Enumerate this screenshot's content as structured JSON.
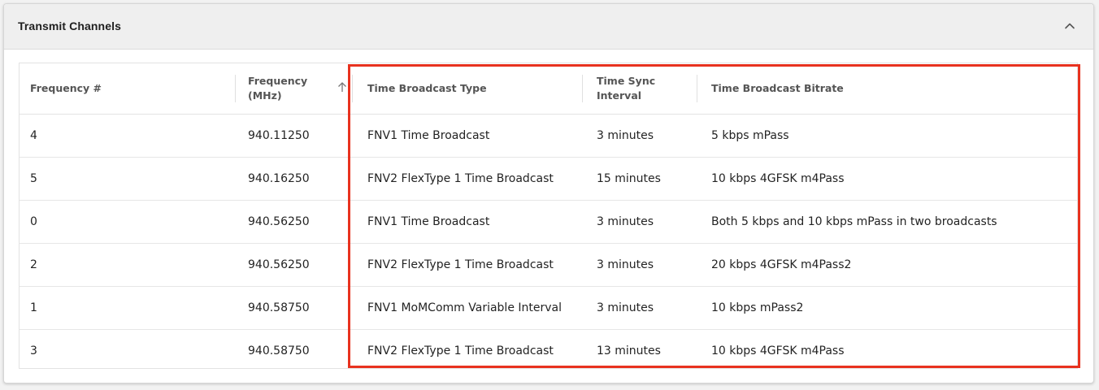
{
  "panel": {
    "title": "Transmit Channels",
    "collapse_icon": "chevron-up-icon"
  },
  "table": {
    "columns": [
      {
        "line1": "Frequency #",
        "line2": ""
      },
      {
        "line1": "Frequency",
        "line2": "(MHz)"
      },
      {
        "line1": "Time Broadcast Type",
        "line2": ""
      },
      {
        "line1": "Time Sync",
        "line2": "Interval"
      },
      {
        "line1": "Time Broadcast Bitrate",
        "line2": ""
      }
    ],
    "sort_icon": "arrow-up-icon",
    "rows": [
      [
        "4",
        "940.11250",
        "FNV1 Time Broadcast",
        "3 minutes",
        "5 kbps mPass"
      ],
      [
        "5",
        "940.16250",
        "FNV2 FlexType 1 Time Broadcast",
        "15 minutes",
        "10 kbps 4GFSK m4Pass"
      ],
      [
        "0",
        "940.56250",
        "FNV1 Time Broadcast",
        "3 minutes",
        "Both 5 kbps and 10 kbps mPass in two broadcasts"
      ],
      [
        "2",
        "940.56250",
        "FNV2 FlexType 1 Time Broadcast",
        "3 minutes",
        "20 kbps 4GFSK m4Pass2"
      ],
      [
        "1",
        "940.58750",
        "FNV1 MoMComm Variable Interval",
        "3 minutes",
        "10 kbps mPass2"
      ],
      [
        "3",
        "940.58750",
        "FNV2 FlexType 1 Time Broadcast",
        "13 minutes",
        "10 kbps 4GFSK m4Pass"
      ]
    ]
  },
  "colors": {
    "highlight": "#e8321f",
    "header_bg": "#efefef"
  }
}
